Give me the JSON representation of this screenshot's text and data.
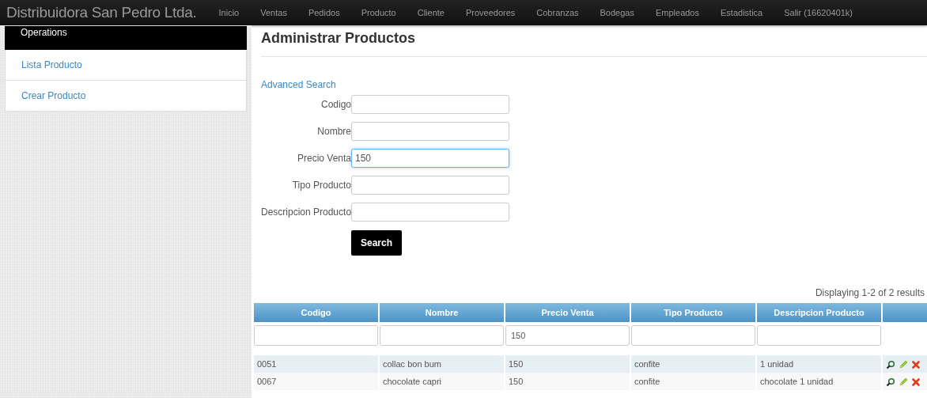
{
  "navbar": {
    "brand": "Distribuidora San Pedro Ltda.",
    "items": [
      "Inicio",
      "Ventas",
      "Pedidos",
      "Producto",
      "Cliente",
      "Proveedores",
      "Cobranzas",
      "Bodegas",
      "Empleados",
      "Estadistica",
      "Salir (16620401k)"
    ]
  },
  "sidebar": {
    "title": "Operations",
    "items": [
      "Lista Producto",
      "Crear Producto"
    ]
  },
  "page_title": "Administrar Productos",
  "advanced_search_link": "Advanced Search",
  "search_form": {
    "fields": [
      {
        "label": "Codigo",
        "focused": false
      },
      {
        "label": "Nombre",
        "focused": false
      },
      {
        "label": "Precio Venta",
        "value": "150",
        "focused": true
      },
      {
        "label": "Tipo Producto",
        "focused": false
      },
      {
        "label": "Descripcion Producto",
        "focused": false
      }
    ],
    "button": "Search"
  },
  "summary": "Displaying 1-2 of 2 results",
  "table": {
    "columns": [
      {
        "label": "Codigo"
      },
      {
        "label": "Nombre"
      },
      {
        "label": "Precio Venta",
        "filter": "150"
      },
      {
        "label": "Tipo Producto"
      },
      {
        "label": "Descripcion Producto"
      }
    ],
    "rows": [
      [
        "0051",
        "collac bon bum",
        "150",
        "confite",
        "1 unidad"
      ],
      [
        "0067",
        "chocolate capri",
        "150",
        "confite",
        "chocolate 1 unidad"
      ]
    ]
  }
}
